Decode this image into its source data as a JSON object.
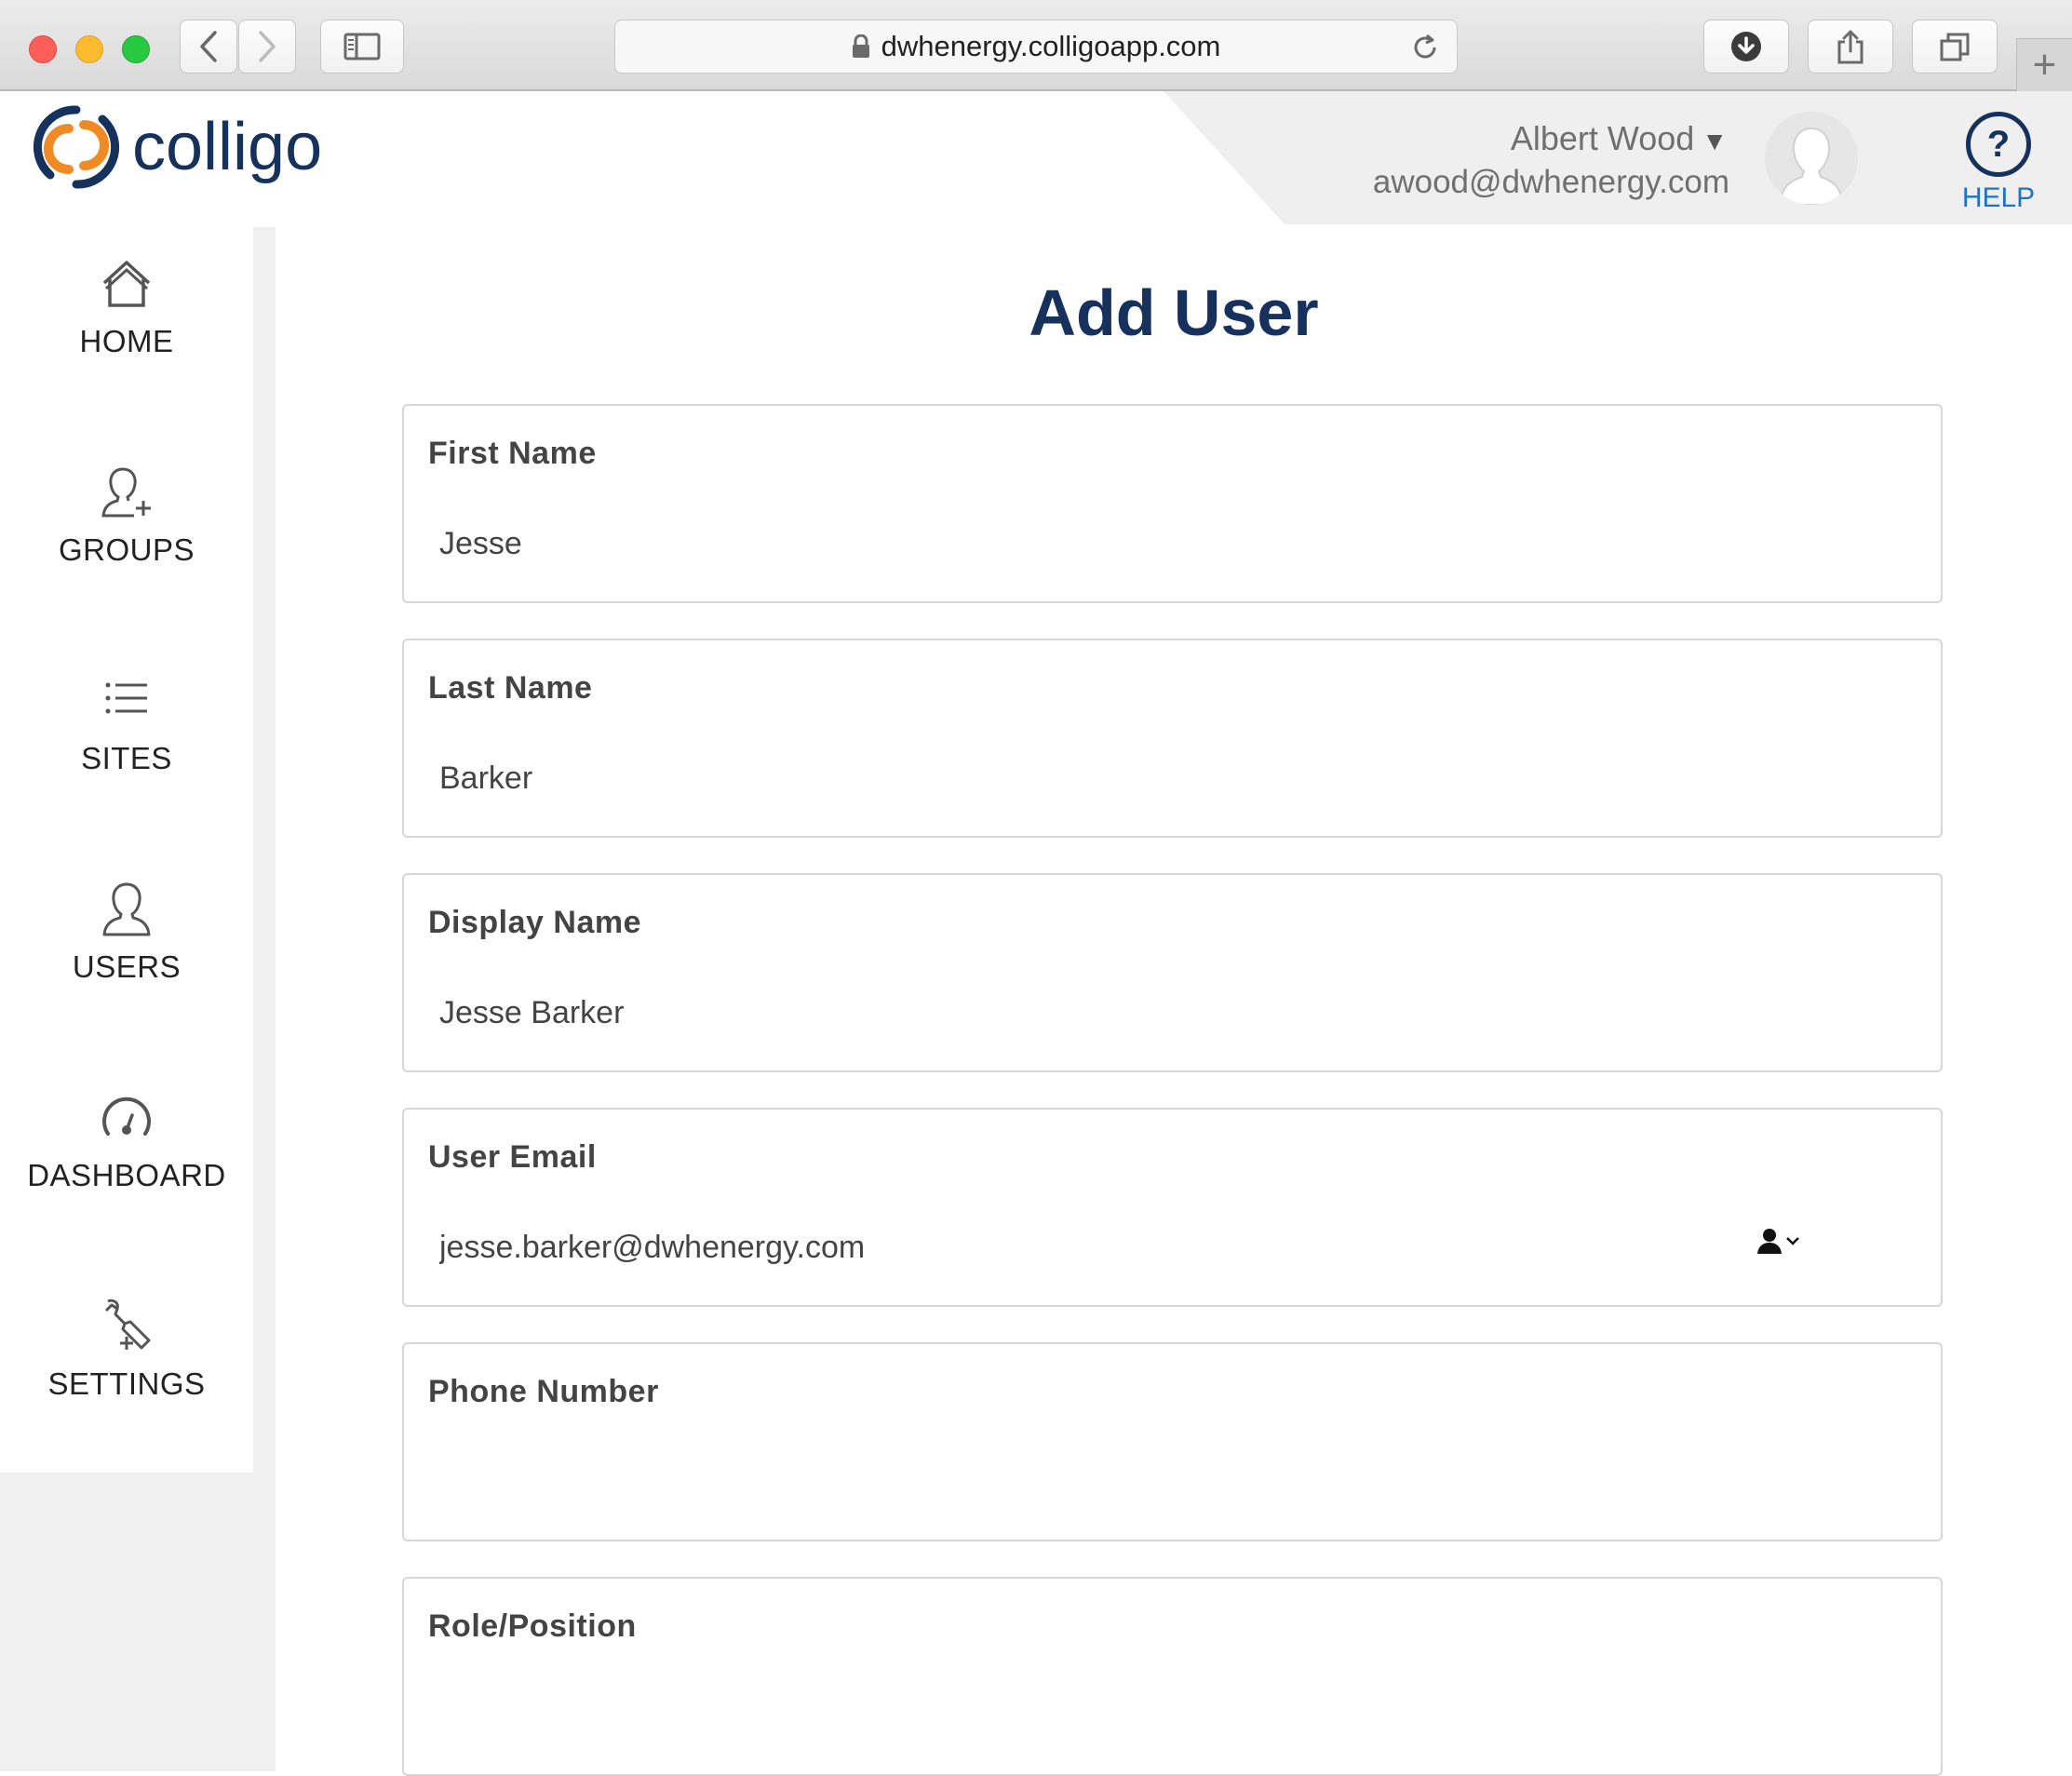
{
  "browser": {
    "url": "dwhenergy.colligoapp.com",
    "new_tab_glyph": "+"
  },
  "header": {
    "logo_text": "colligo",
    "user_name": "Albert Wood",
    "user_caret": "▼",
    "user_email": "awood@dwhenergy.com",
    "help_glyph": "?",
    "help_label": "HELP"
  },
  "sidebar": {
    "items": [
      {
        "label": "HOME",
        "icon": "home-icon"
      },
      {
        "label": "GROUPS",
        "icon": "add-user-icon"
      },
      {
        "label": "SITES",
        "icon": "list-icon"
      },
      {
        "label": "USERS",
        "icon": "user-icon"
      },
      {
        "label": "DASHBOARD",
        "icon": "gauge-icon"
      },
      {
        "label": "SETTINGS",
        "icon": "wrench-icon"
      }
    ]
  },
  "main": {
    "title": "Add User",
    "fields": [
      {
        "label": "First Name",
        "value": "Jesse"
      },
      {
        "label": "Last Name",
        "value": "Barker"
      },
      {
        "label": "Display Name",
        "value": "Jesse Barker"
      },
      {
        "label": "User Email",
        "value": "jesse.barker@dwhenergy.com"
      },
      {
        "label": "Phone Number",
        "value": ""
      },
      {
        "label": "Role/Position",
        "value": ""
      }
    ]
  },
  "colors": {
    "brand_navy": "#16325c",
    "brand_orange": "#f08a24",
    "link_blue": "#1e73c8"
  }
}
